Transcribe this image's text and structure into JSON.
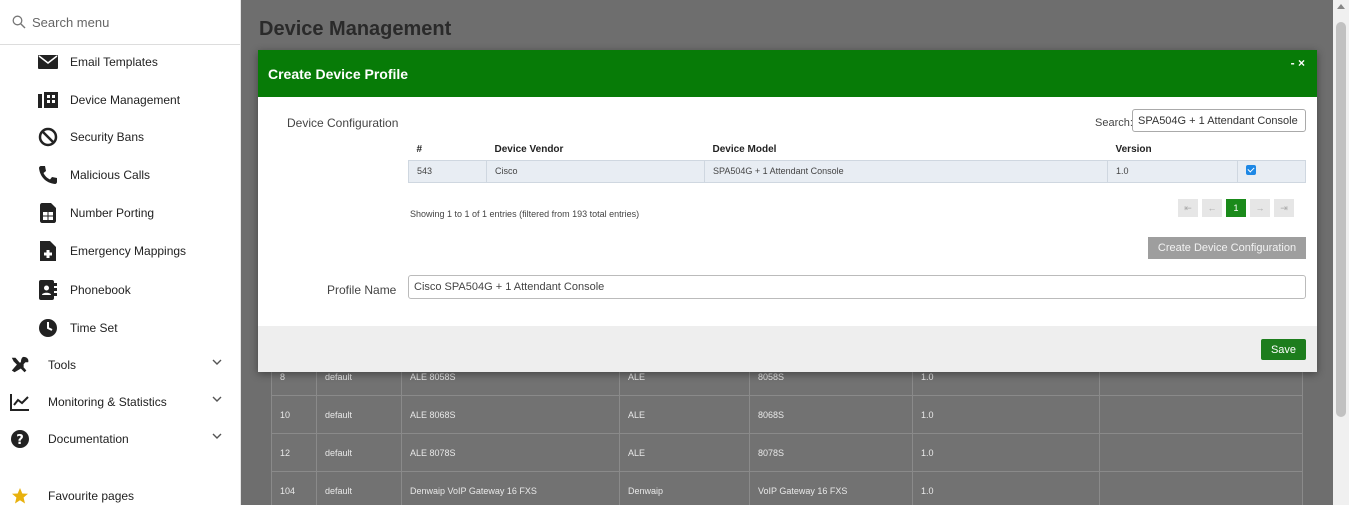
{
  "sidebar": {
    "search_placeholder": "Search menu",
    "items": [
      {
        "label": "Email Templates",
        "icon": "envelope-icon"
      },
      {
        "label": "Device Management",
        "icon": "device-management-icon"
      },
      {
        "label": "Security Bans",
        "icon": "ban-icon"
      },
      {
        "label": "Malicious Calls",
        "icon": "phone-icon"
      },
      {
        "label": "Number Porting",
        "icon": "sim-card-icon"
      },
      {
        "label": "Emergency Mappings",
        "icon": "file-medical-icon"
      },
      {
        "label": "Phonebook",
        "icon": "address-book-icon"
      },
      {
        "label": "Time Set",
        "icon": "clock-icon"
      }
    ],
    "sections": [
      {
        "label": "Tools",
        "icon": "tools-icon"
      },
      {
        "label": "Monitoring & Statistics",
        "icon": "chart-line-icon"
      },
      {
        "label": "Documentation",
        "icon": "question-circle-icon"
      },
      {
        "label": "Favourite pages",
        "icon": "star-icon"
      }
    ]
  },
  "page": {
    "title": "Device Management",
    "bg_rows": [
      [
        "8",
        "default",
        "ALE 8058S",
        "ALE",
        "8058S",
        "1.0",
        ""
      ],
      [
        "10",
        "default",
        "ALE 8068S",
        "ALE",
        "8068S",
        "1.0",
        ""
      ],
      [
        "12",
        "default",
        "ALE 8078S",
        "ALE",
        "8078S",
        "1.0",
        ""
      ],
      [
        "104",
        "default",
        "Denwaip VoIP Gateway 16 FXS",
        "Denwaip",
        "VoIP Gateway 16 FXS",
        "1.0",
        ""
      ]
    ]
  },
  "modal": {
    "title": "Create Device Profile",
    "controls": "- ×",
    "device_configuration_label": "Device Configuration",
    "search_label": "Search:",
    "search_value": "SPA504G + 1 Attendant Console",
    "table": {
      "headers": [
        "#",
        "Device Vendor",
        "Device Model",
        "Version",
        ""
      ],
      "rows": [
        {
          "id": "543",
          "vendor": "Cisco",
          "model": "SPA504G + 1 Attendant Console",
          "version": "1.0",
          "checked": true
        }
      ]
    },
    "showing_text": "Showing 1 to 1 of 1 entries (filtered from 193 total entries)",
    "pager": {
      "first": "⇤",
      "prev": "←",
      "current": "1",
      "next": "→",
      "last": "⇥"
    },
    "create_config_button": "Create Device Configuration",
    "profile_name_label": "Profile Name",
    "profile_name_value": "Cisco SPA504G + 1 Attendant Console",
    "save_button": "Save"
  },
  "colors": {
    "modal_header": "#077b07",
    "save_button": "#1d7d1d",
    "overlay": "#6e6e6e"
  }
}
